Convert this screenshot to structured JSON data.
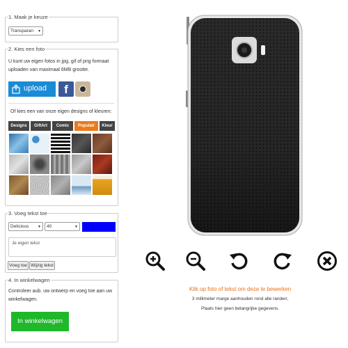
{
  "step1": {
    "title": "1. Maak je keuze",
    "select_value": "Transparan"
  },
  "step2": {
    "title": "2. Kies een foto",
    "description": "U kunt uw eigen fotos in jpg, gif of png formaat uploaden van maximaal 6MB grootte.",
    "upload_label": "upload",
    "designs_text": "Of kies een van onze eigen designs of kleuren:",
    "tabs": [
      "Designs",
      "GiftArt",
      "Comic",
      "Populair",
      "Kleur"
    ],
    "active_tab": "Populair"
  },
  "step3": {
    "title": "3. Voeg tekst toe",
    "font_value": "Delicious",
    "size_value": "40",
    "color": "#0000ff",
    "text_placeholder": "Je eigen tekst",
    "add_label": "Voeg toe",
    "edit_label": "Wijzig tekst"
  },
  "step4": {
    "title": "4. In winkelwagen",
    "description": "Controleer aub. uw ontwerp en voeg toe aan uw winkelwagen.",
    "cart_label": "In winkelwagen"
  },
  "editor": {
    "hint": "Klik op foto of tekst om deze te bewerken",
    "note1": "3 millimeter marge aanhouden rond alle randen;",
    "note2": "Plaats hier geen belangrijke gegevens."
  },
  "controls": [
    "zoom-in-icon",
    "zoom-out-icon",
    "rotate-left-icon",
    "rotate-right-icon",
    "delete-icon"
  ],
  "colors": {
    "accent": "#ea7a1c",
    "upload_blue": "#1a8bd6",
    "cart_green": "#1fb82b",
    "hint_orange": "#e8701a"
  }
}
